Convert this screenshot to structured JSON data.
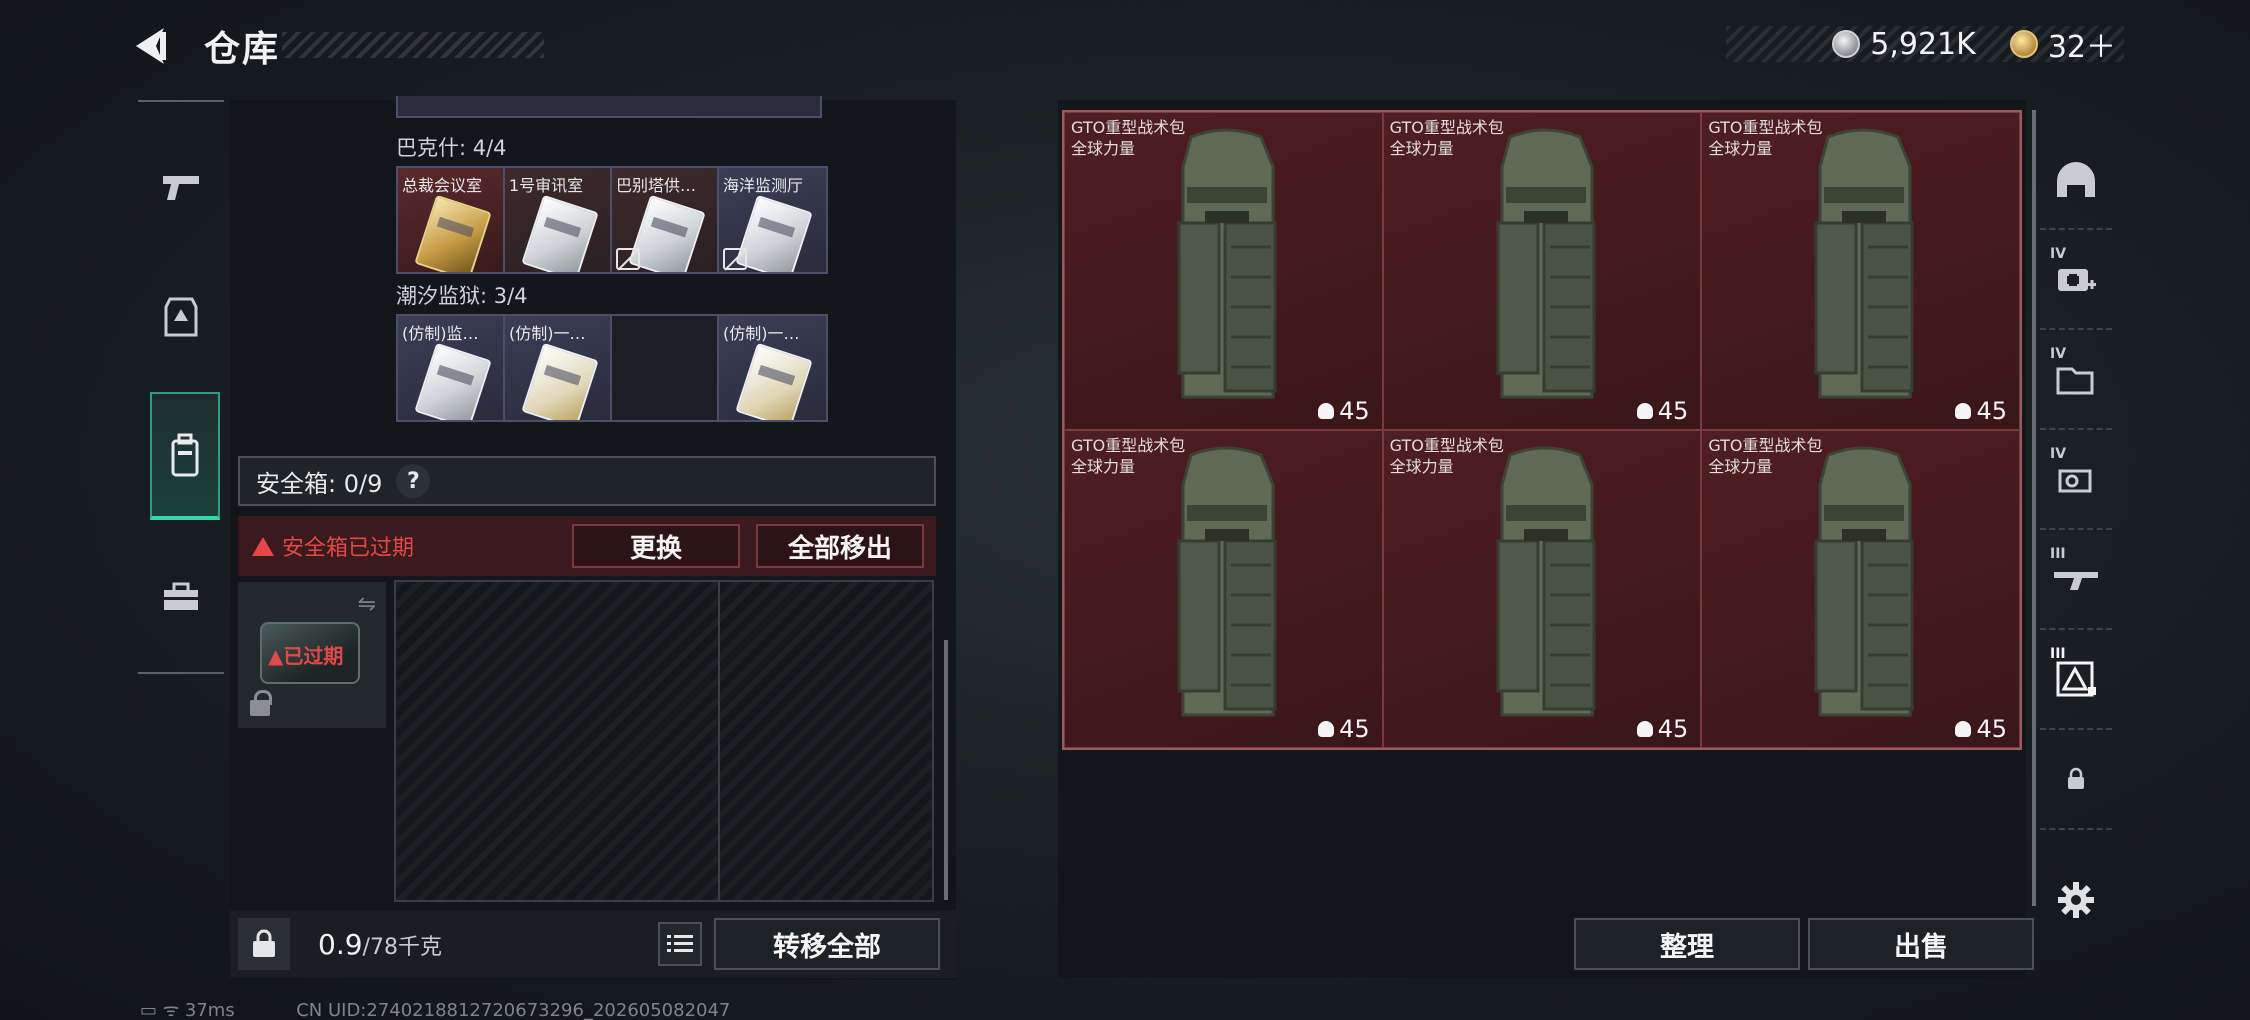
{
  "header": {
    "title": "仓库"
  },
  "currency": {
    "silver": "5,921K",
    "gold": "32＋"
  },
  "left_nav": [
    "pistol-icon",
    "armor-icon",
    "backpack-icon",
    "toolbox-icon"
  ],
  "cards": {
    "bakeshi": {
      "label": "巴克什: 4/4",
      "items": [
        {
          "name": "总裁会议室",
          "style": "gold",
          "no_trade": false
        },
        {
          "name": "1号审讯室",
          "style": "white",
          "no_trade": false
        },
        {
          "name": "巴别塔供…",
          "style": "white",
          "no_trade": true
        },
        {
          "name": "海洋监测厅",
          "style": "white",
          "no_trade": true
        }
      ]
    },
    "chaoxi": {
      "label": "潮汐监狱: 3/4",
      "items": [
        {
          "name": "(仿制)监…",
          "style": "white"
        },
        {
          "name": "(仿制)一…",
          "style": "yellow"
        },
        {
          "name": "",
          "style": "empty"
        },
        {
          "name": "(仿制)一…",
          "style": "yellow"
        }
      ]
    }
  },
  "safe_box": {
    "label": "安全箱: 0/9",
    "help": "?",
    "expired_msg": "安全箱已过期",
    "replace_btn": "更换",
    "remove_all_btn": "全部移出",
    "box_status": "已过期"
  },
  "bottom_left": {
    "weight": "0.9",
    "weight_max": "/78千克",
    "transfer_btn": "转移全部"
  },
  "backpacks": [
    {
      "name": "GTO重型战术包",
      "sub": "全球力量",
      "count": "45"
    },
    {
      "name": "GTO重型战术包",
      "sub": "全球力量",
      "count": "45"
    },
    {
      "name": "GTO重型战术包",
      "sub": "全球力量",
      "count": "45"
    },
    {
      "name": "GTO重型战术包",
      "sub": "全球力量",
      "count": "45"
    },
    {
      "name": "GTO重型战术包",
      "sub": "全球力量",
      "count": "45"
    },
    {
      "name": "GTO重型战术包",
      "sub": "全球力量",
      "count": "45"
    }
  ],
  "bottom_right": {
    "sort_btn": "整理",
    "sell_btn": "出售"
  },
  "right_nav": [
    {
      "icon": "helmet-icon",
      "roman": ""
    },
    {
      "icon": "med-plus-icon",
      "roman": "IV"
    },
    {
      "icon": "folder-icon",
      "roman": "IV"
    },
    {
      "icon": "key-icon",
      "roman": "IV"
    },
    {
      "icon": "rifle-icon",
      "roman": "III"
    },
    {
      "icon": "map-icon",
      "roman": "III"
    },
    {
      "icon": "lock-icon",
      "roman": ""
    }
  ],
  "status": {
    "ping": "37ms",
    "uid": "CN UID:2740218812720673296_202605082047"
  },
  "colors": {
    "accent": "#36d6a6",
    "warning": "#e34848",
    "item_bg": "#4e1e22"
  }
}
